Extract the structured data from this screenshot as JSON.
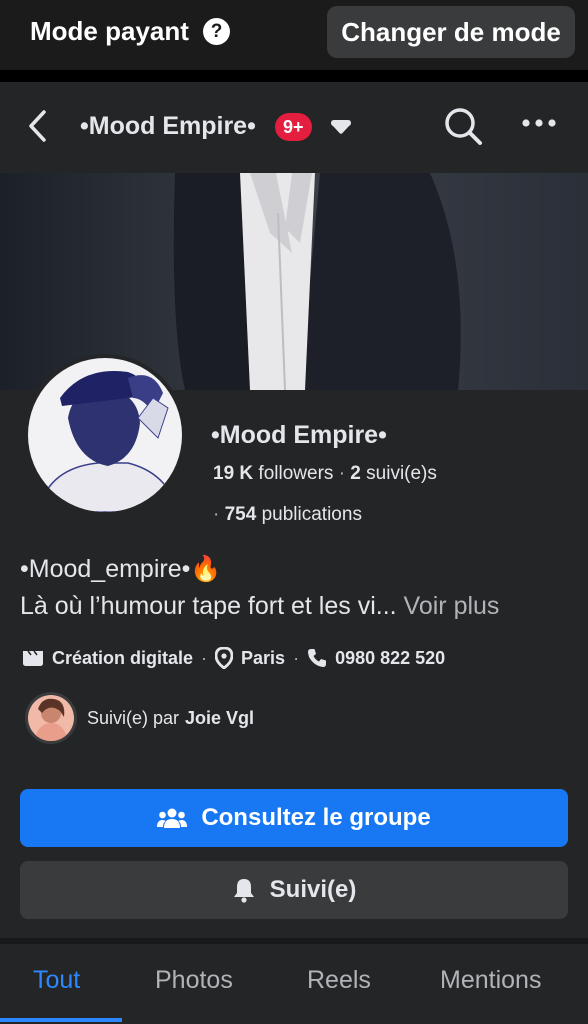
{
  "mode_bar": {
    "label": "Mode payant",
    "help_glyph": "?",
    "switch_button": "Changer de mode"
  },
  "header": {
    "title": "•Mood Empire•",
    "badge": "9+"
  },
  "profile": {
    "name": "•Mood Empire•",
    "followers_count": "19 K",
    "followers_label": "followers",
    "following_count": "2",
    "following_label": "suivi(e)s",
    "posts_count": "754",
    "posts_label": "publications"
  },
  "bio": {
    "line1": "•Mood_empire•🔥",
    "line2": "Là où l’humour tape fort et les vi...",
    "more": "Voir plus"
  },
  "info": {
    "category": "Création digitale",
    "location": "Paris",
    "phone": "0980 822 520"
  },
  "followed_by": {
    "prefix": "Suivi(e) par",
    "name": "Joie Vgl"
  },
  "buttons": {
    "group": "Consultez le groupe",
    "follow": "Suivi(e)"
  },
  "tabs": [
    "Tout",
    "Photos",
    "Reels",
    "Mentions"
  ],
  "colors": {
    "accent": "#1877f2",
    "badge": "#e41e3f",
    "background": "#242526"
  },
  "icons": [
    "help-icon",
    "back-arrow-icon",
    "caret-down-icon",
    "search-icon",
    "more-icon",
    "category-icon",
    "location-pin-icon",
    "phone-icon",
    "group-icon",
    "bell-icon"
  ]
}
